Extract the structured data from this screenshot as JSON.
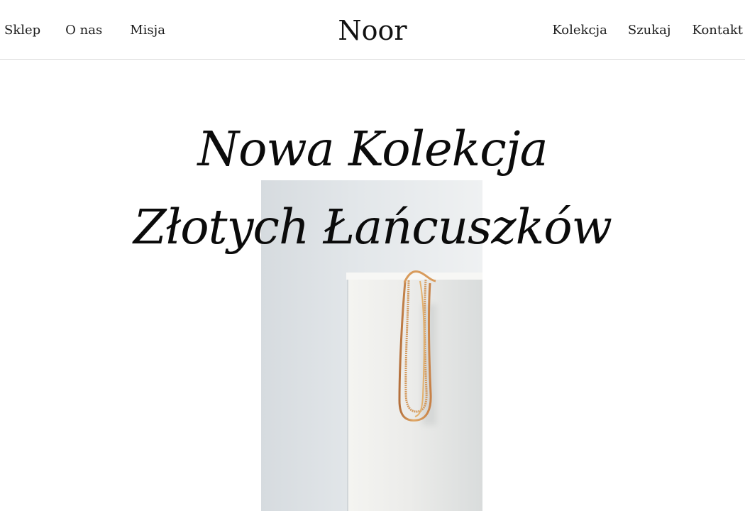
{
  "header": {
    "left_nav": [
      {
        "label": "Sklep"
      },
      {
        "label": "O nas"
      },
      {
        "label": "Misja"
      }
    ],
    "brand": "Noor",
    "right_nav": [
      {
        "label": "Kolekcja"
      },
      {
        "label": "Szukaj"
      },
      {
        "label": "Kontakt"
      }
    ]
  },
  "hero": {
    "title_line1": "Nowa Kolekcja",
    "title_line2": "Złotych Łańcuszków"
  },
  "colors": {
    "background": "#ffffff",
    "text": "#111111",
    "divider": "#dddddd",
    "gold_chain": "#d19a57"
  }
}
